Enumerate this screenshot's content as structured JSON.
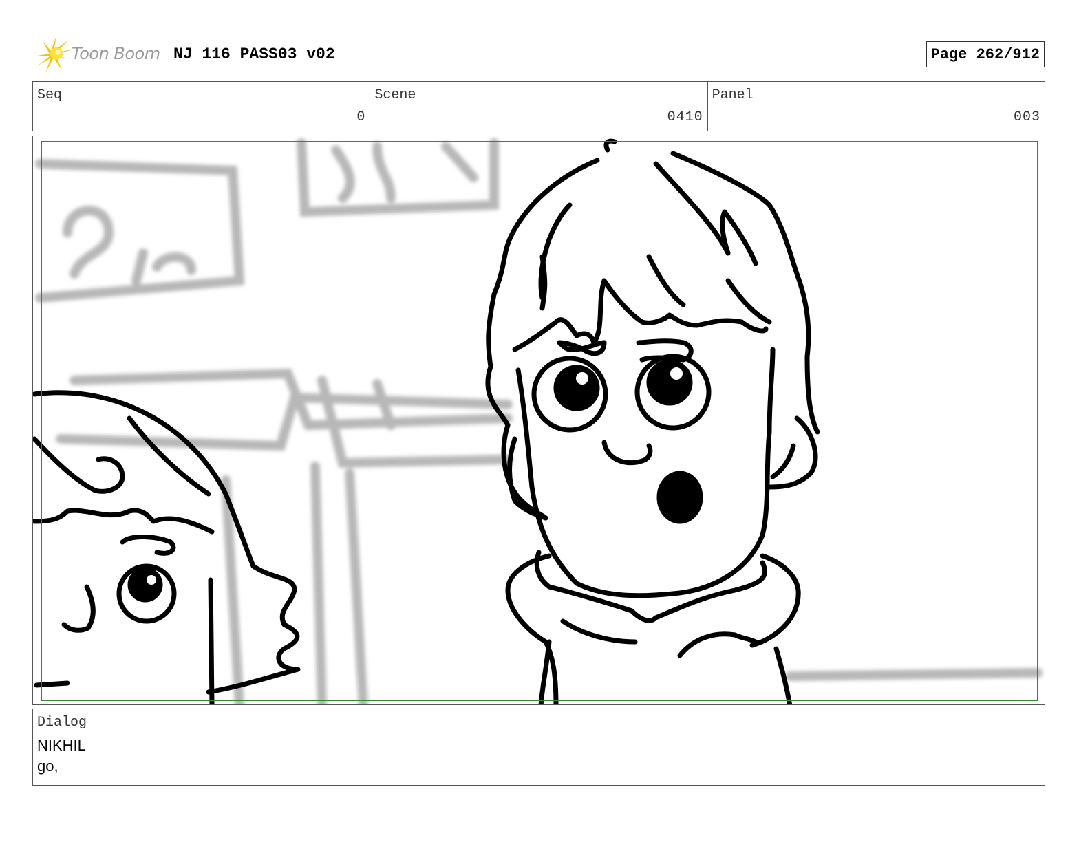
{
  "header": {
    "logo_text": "Toon Boom",
    "title": "NJ 116 PASS03 v02",
    "page": "Page 262/912"
  },
  "info": {
    "seq_label": "Seq",
    "seq_value": "0",
    "scene_label": "Scene",
    "scene_value": "0410",
    "panel_label": "Panel",
    "panel_value": "003"
  },
  "dialog": {
    "label": "Dialog",
    "speaker": "NIKHIL",
    "line": "go,"
  },
  "colors": {
    "safe_frame": "#2e8b2e",
    "logo_star": "#f5c400"
  }
}
